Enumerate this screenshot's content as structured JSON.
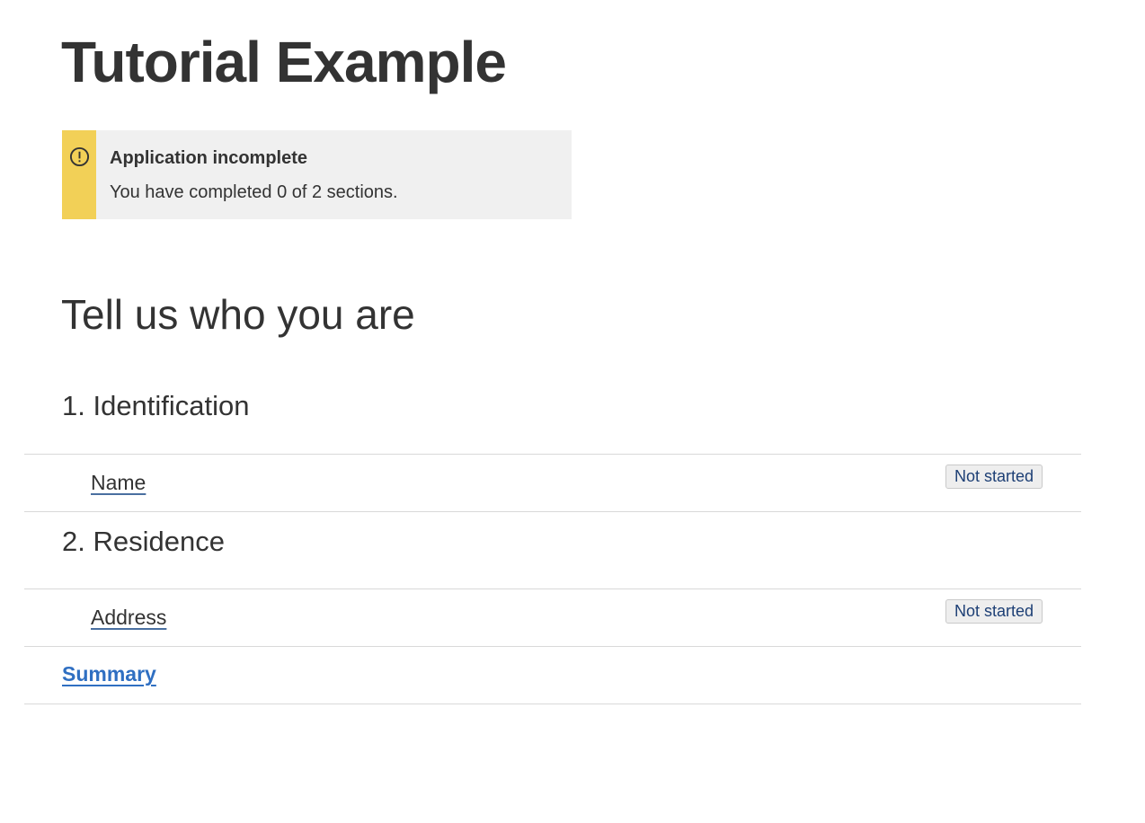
{
  "page": {
    "title": "Tutorial Example"
  },
  "status_panel": {
    "icon": "alert-circle-icon",
    "heading": "Application incomplete",
    "message": "You have completed 0 of 2 sections.",
    "accent_color": "#f2d057",
    "background_color": "#f0f0f0"
  },
  "main": {
    "section_title": "Tell us who you are",
    "groups": [
      {
        "title": "1. Identification",
        "tasks": [
          {
            "label": "Name",
            "status": "Not started"
          }
        ]
      },
      {
        "title": "2. Residence",
        "tasks": [
          {
            "label": "Address",
            "status": "Not started"
          }
        ]
      }
    ],
    "summary_link": "Summary",
    "link_color": "#2f6fc2",
    "tag_text_color": "#1d3f75"
  }
}
